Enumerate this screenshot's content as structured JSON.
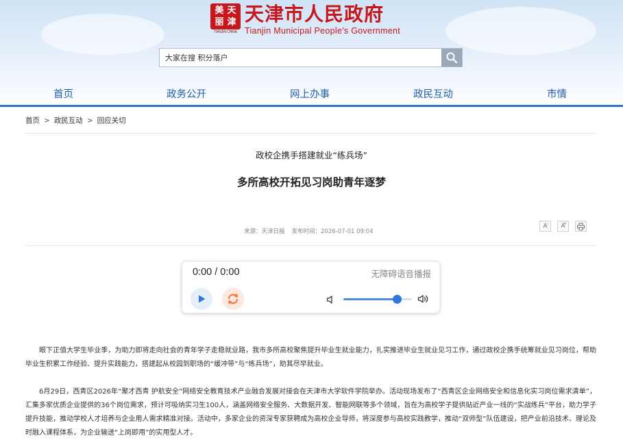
{
  "header": {
    "seal_chars": [
      "美",
      "天",
      "丽",
      "津"
    ],
    "seal_caption": "TIANJIN·CHINA",
    "site_title_cn": "天津市人民政府",
    "site_title_en": "Tianjin Municipal People's Government",
    "search_placeholder": "大家在搜 积分落户",
    "search_icon": "magnifier-icon"
  },
  "nav": {
    "items": [
      "首页",
      "政务公开",
      "网上办事",
      "政民互动",
      "市情"
    ]
  },
  "breadcrumb": {
    "items": [
      "首页",
      "政民互动",
      "回应关切"
    ],
    "separator": ">"
  },
  "article": {
    "subtitle": "政校企携手搭建就业“练兵场”",
    "title": "多所高校开拓见习岗助青年逐梦",
    "source": "来源：天津日报",
    "publish_time": "发布时间：2026-07-01 09:04",
    "tools": [
      "A-",
      "A+",
      "print-icon"
    ],
    "paragraphs": [
      "眼下正值大学生毕业季，为助力即将走向社会的青年学子走稳就业路，我市多所高校聚焦提升毕业生就业能力，扎实推进毕业生就业见习工作，通过政校企携手统筹就业见习岗位，帮助毕业生积累工作经验、提升实践能力，搭建起从校园到职场的“缓冲带”与“练兵场”，助其尽早就业。",
      "6月29日，西青区2026年“聚才西青 护航安全”网络安全教育技术产业融合发展对接会在天津市大学软件学院举办。活动现场发布了“西青区企业网络安全和信息化实习岗位需求清单”，汇集多家优质企业提供的36个岗位需求，预计可吸纳实习生100人，涵盖网络安全服务、大数据开发、智能网联等多个领域，旨在为高校学子提供贴近产业一线的“实战练兵”平台，助力学子提升技能，推动学校人才培养与企业用人需求精准对接。活动中，多家企业的资深专家获聘成为高校企业导师，将深度参与高校实践教学，推动“双师型”队伍建设，把产业前沿技术、理论及时融入课程体系，为企业输送“上岗即用”的实用型人才。"
    ]
  },
  "player": {
    "time_display": "0:00 / 0:00",
    "accessibility_label": "无障碍语音播报",
    "volume_level": 0.78,
    "accent_color": "#2f77db"
  },
  "colors": {
    "brand_red": "#c8161d",
    "nav_blue": "#1d5fae"
  }
}
